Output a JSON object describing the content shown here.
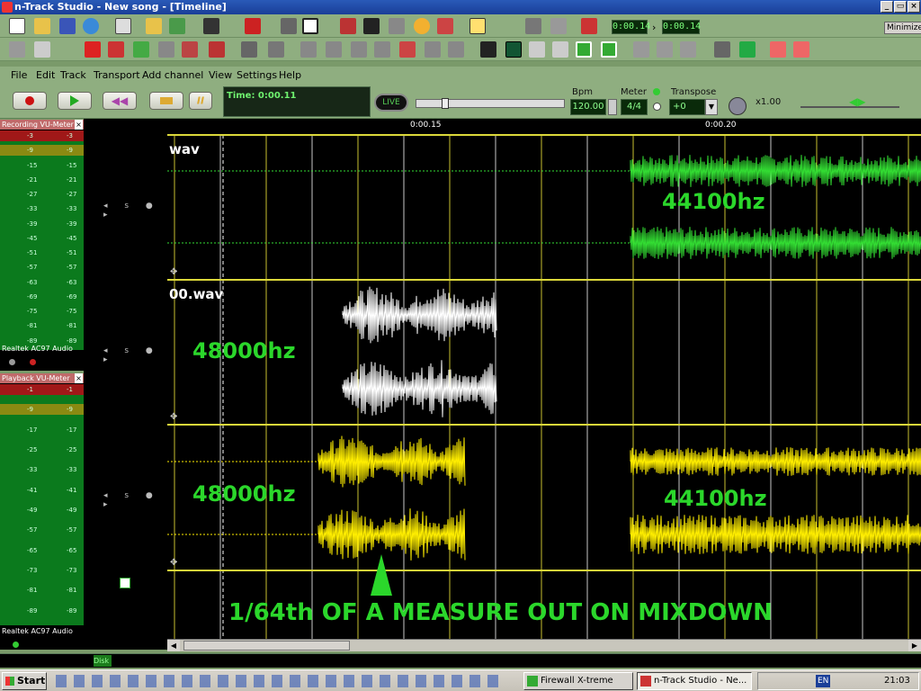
{
  "titlebar": {
    "title": "n-Track Studio - New song - [Timeline]"
  },
  "toolbar": {
    "time_start": "0:00.14",
    "time_end": "0:00.14",
    "minimize_label": "Minimize"
  },
  "menu": [
    "File",
    "Edit",
    "Track",
    "Transport",
    "Add channel",
    "View",
    "Settings",
    "Help"
  ],
  "transport": {
    "time_display": "Time: 0:00.11",
    "live_label": "LIVE",
    "bpm_label": "Bpm",
    "bpm_value": "120.00",
    "meter_label": "Meter",
    "meter_value": "4/4",
    "transpose_label": "Transpose",
    "transpose_value": "+0",
    "speed_value": "x1.00"
  },
  "recording_vu": {
    "title": "Recording VU-Meter",
    "device": "Realtek AC97 Audio",
    "scale": [
      "-3",
      "-9",
      "-15",
      "-21",
      "-27",
      "-33",
      "-39",
      "-45",
      "-51",
      "-57",
      "-63",
      "-69",
      "-75",
      "-81",
      "-89"
    ]
  },
  "playback_vu": {
    "title": "Playback VU-Meter",
    "device": "Realtek AC97 Audio",
    "scale": [
      "-1",
      "-9",
      "-17",
      "-25",
      "-33",
      "-41",
      "-49",
      "-57",
      "-65",
      "-73",
      "-81",
      "-89"
    ]
  },
  "ruler": {
    "mark1": "0:00.15",
    "mark2": "0:00.20"
  },
  "tracks": [
    {
      "name": "wav",
      "color": "#33dd33"
    },
    {
      "name": "00.wav",
      "color": "#ffffff"
    },
    {
      "name": "",
      "color": "#ffee00"
    }
  ],
  "annotations": {
    "rate1": "44100hz",
    "rate2": "48000hz",
    "rate3": "48000hz",
    "rate4": "44100hz",
    "note": "1/64th OF A MEASURE OUT ON MIXDOWN",
    "annotation_color": "#2bd72b"
  },
  "status": {
    "disk": "Disk"
  },
  "taskbar": {
    "start": "Start",
    "task1": "Firewall X-treme",
    "task2": "n-Track Studio - Ne...",
    "lang": "EN",
    "clock": "21:03"
  }
}
